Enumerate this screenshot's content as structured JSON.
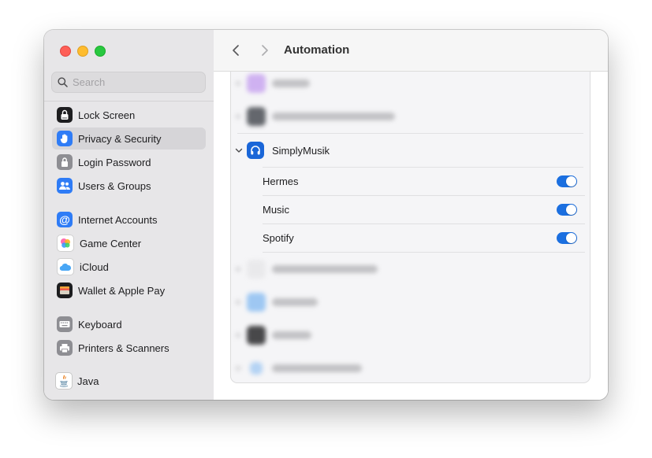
{
  "window": {
    "title": "Automation"
  },
  "search": {
    "placeholder": "Search"
  },
  "sidebar": {
    "items": [
      {
        "label": "Lock Screen",
        "icon": "lock-screen-icon",
        "color": "#1d1d1f"
      },
      {
        "label": "Privacy & Security",
        "icon": "hand-icon",
        "color": "#2f7cf6",
        "selected": true
      },
      {
        "label": "Login Password",
        "icon": "padlock-icon",
        "color": "#8e8e93"
      },
      {
        "label": "Users & Groups",
        "icon": "users-icon",
        "color": "#2f7cf6"
      },
      {
        "label": "Internet Accounts",
        "icon": "at-sign-icon",
        "color": "#2f7cf6"
      },
      {
        "label": "Game Center",
        "icon": "game-center-icon",
        "color": "#ffffff"
      },
      {
        "label": "iCloud",
        "icon": "cloud-icon",
        "color": "#ffffff"
      },
      {
        "label": "Wallet & Apple Pay",
        "icon": "wallet-icon",
        "color": "#1d1d1f"
      },
      {
        "label": "Keyboard",
        "icon": "keyboard-icon",
        "color": "#8e8e93"
      },
      {
        "label": "Printers & Scanners",
        "icon": "printer-icon",
        "color": "#8e8e93"
      },
      {
        "label": "Java",
        "icon": "java-icon",
        "color": "#ffffff"
      }
    ]
  },
  "automation": {
    "expanded_app": {
      "name": "SimplyMusik",
      "icon": "headphones-icon",
      "permissions": [
        {
          "label": "Hermes",
          "enabled": true
        },
        {
          "label": "Music",
          "enabled": true
        },
        {
          "label": "Spotify",
          "enabled": true
        }
      ]
    }
  },
  "colors": {
    "accent": "#1b6fe0",
    "selection": "#d6d5d8"
  }
}
